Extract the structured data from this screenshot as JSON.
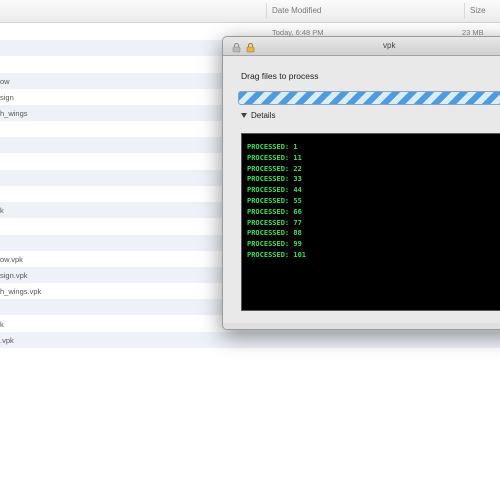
{
  "finder": {
    "columns": {
      "date": "Date Modified",
      "size": "Size"
    },
    "rows": [
      {
        "name": "",
        "date": "Today, 6:48 PM",
        "size": "23 MB"
      },
      {
        "name": "",
        "date": "",
        "size": ""
      },
      {
        "name": "",
        "date": "",
        "size": ""
      },
      {
        "name": "ow",
        "date": "",
        "size": ""
      },
      {
        "name": "sign",
        "date": "",
        "size": ""
      },
      {
        "name": "h_wings",
        "date": "",
        "size": ""
      },
      {
        "name": "",
        "date": "",
        "size": ""
      },
      {
        "name": "",
        "date": "",
        "size": ""
      },
      {
        "name": "",
        "date": "",
        "size": ""
      },
      {
        "name": "",
        "date": "",
        "size": ""
      },
      {
        "name": "",
        "date": "",
        "size": ""
      },
      {
        "name": "k",
        "date": "",
        "size": ""
      },
      {
        "name": "",
        "date": "",
        "size": ""
      },
      {
        "name": "",
        "date": "",
        "size": ""
      },
      {
        "name": "ow.vpk",
        "date": "",
        "size": ""
      },
      {
        "name": "sign.vpk",
        "date": "",
        "size": ""
      },
      {
        "name": "h_wings.vpk",
        "date": "",
        "size": ""
      },
      {
        "name": "",
        "date": "",
        "size": ""
      },
      {
        "name": "k",
        "date": "",
        "size": ""
      },
      {
        "name": ".vpk",
        "date": "",
        "size": ""
      }
    ]
  },
  "window": {
    "title": "vpk",
    "drag_label": "Drag files to process",
    "progress_indeterminate": true,
    "details_label": "Details",
    "console_lines": [
      "PROCESSED: 1",
      "PROCESSED: 11",
      "PROCESSED: 22",
      "PROCESSED: 33",
      "PROCESSED: 44",
      "PROCESSED: 55",
      "PROCESSED: 66",
      "PROCESSED: 77",
      "PROCESSED: 88",
      "PROCESSED: 99",
      "PROCESSED: 101"
    ]
  },
  "colors": {
    "console_text": "#39e05a",
    "console_bg": "#000000",
    "progress_stripe": "#4f9be0",
    "row_alt": "#eef2f8"
  },
  "icons": [
    "lock-icon",
    "padlock-icon",
    "disclosure-triangle-icon"
  ]
}
